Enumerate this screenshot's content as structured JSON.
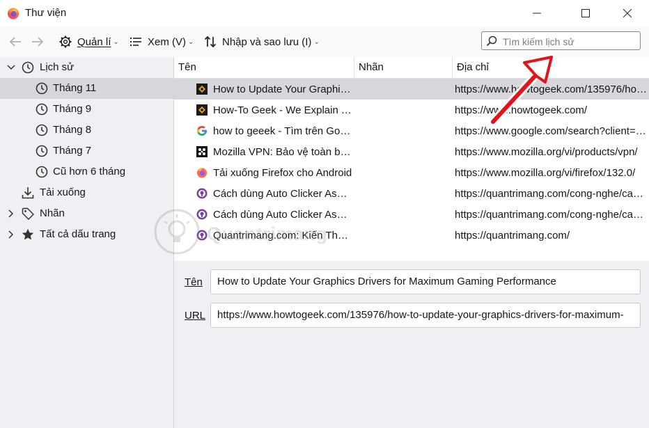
{
  "window": {
    "title": "Thư viện"
  },
  "toolbar": {
    "manage_label": "Quản lí",
    "view_label": "Xem (V)",
    "import_label": "Nhập và sao lưu (I)"
  },
  "search": {
    "placeholder": "Tìm kiếm lịch sử"
  },
  "sidebar": {
    "history": "Lịch sử",
    "months": [
      "Tháng 11",
      "Tháng 9",
      "Tháng 8",
      "Tháng 7",
      "Cũ hơn 6 tháng"
    ],
    "downloads": "Tải xuống",
    "tags": "Nhãn",
    "bookmarks": "Tất cả dấu trang"
  },
  "table": {
    "headers": {
      "name": "Tên",
      "tags": "Nhãn",
      "address": "Địa chỉ"
    },
    "rows": [
      {
        "title": "How to Update Your Graphics Drivers for Maximum Gaming Performance",
        "url": "https://www.howtogeek.com/135976/how-to-update-your-graphics-drivers-for-maximum-",
        "icon": "howtogeek-favicon"
      },
      {
        "title": "How-To Geek - We Explain Technology",
        "url": "https://www.howtogeek.com/",
        "icon": "howtogeek-favicon"
      },
      {
        "title": "how to geeek - Tìm trên Google",
        "url": "https://www.google.com/search?client=firefox",
        "icon": "google-favicon"
      },
      {
        "title": "Mozilla VPN: Bảo vệ toàn bộ thiết bị",
        "url": "https://www.mozilla.org/vi/products/vpn/",
        "icon": "mozilla-vpn-favicon"
      },
      {
        "title": "Tải xuống Firefox cho Android",
        "url": "https://www.mozilla.org/vi/firefox/132.0/",
        "icon": "firefox-favicon"
      },
      {
        "title": "Cách dùng Auto Clicker Assistant",
        "url": "https://quantrimang.com/cong-nghe/cach-dung",
        "icon": "quantrimang-favicon"
      },
      {
        "title": "Cách dùng Auto Clicker Assistant",
        "url": "https://quantrimang.com/cong-nghe/cach-dung",
        "icon": "quantrimang-favicon"
      },
      {
        "title": "Quantrimang.com: Kiến Thức Công Nghệ",
        "url": "https://quantrimang.com/",
        "icon": "quantrimang-favicon"
      }
    ]
  },
  "details": {
    "name_label": "Tên",
    "name_value": "How to Update Your Graphics Drivers for Maximum Gaming Performance",
    "url_label": "URL",
    "url_value": "https://www.howtogeek.com/135976/how-to-update-your-graphics-drivers-for-maximum-"
  },
  "watermark": "Quantrimang",
  "colors": {
    "selected_row": "#d7d7db",
    "search_border": "#5b8fd6",
    "annotation_arrow": "#e2141b"
  }
}
